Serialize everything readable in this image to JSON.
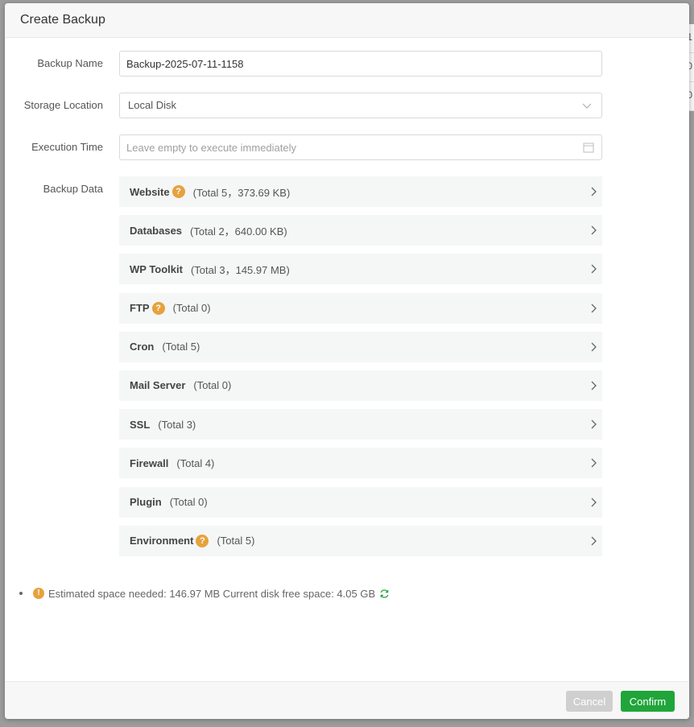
{
  "background": {
    "row_fragments": [
      "1",
      "0",
      "0"
    ]
  },
  "dialog": {
    "title": "Create Backup"
  },
  "form": {
    "backup_name": {
      "label": "Backup Name",
      "value": "Backup-2025-07-11-1158"
    },
    "storage_location": {
      "label": "Storage Location",
      "value": "Local Disk"
    },
    "execution_time": {
      "label": "Execution Time",
      "placeholder": "Leave empty to execute immediately"
    },
    "backup_data": {
      "label": "Backup Data",
      "items": [
        {
          "name": "Website",
          "help": true,
          "count": "(Total 5，373.69 KB)"
        },
        {
          "name": "Databases",
          "help": false,
          "count": "(Total 2，640.00 KB)"
        },
        {
          "name": "WP Toolkit",
          "help": false,
          "count": "(Total 3，145.97 MB)"
        },
        {
          "name": "FTP",
          "help": true,
          "count": "(Total 0)"
        },
        {
          "name": "Cron",
          "help": false,
          "count": "(Total 5)"
        },
        {
          "name": "Mail Server",
          "help": false,
          "count": "(Total 0)"
        },
        {
          "name": "SSL",
          "help": false,
          "count": "(Total 3)"
        },
        {
          "name": "Firewall",
          "help": false,
          "count": "(Total 4)"
        },
        {
          "name": "Plugin",
          "help": false,
          "count": "(Total 0)"
        },
        {
          "name": "Environment",
          "help": true,
          "count": "(Total 5)"
        }
      ]
    }
  },
  "estimate": {
    "text": "Estimated space needed: 146.97 MB Current disk free space: 4.05 GB"
  },
  "footer": {
    "cancel_label": "Cancel",
    "confirm_label": "Confirm"
  },
  "icons": {
    "help": "?",
    "warning": "!",
    "refresh": "refresh-icon",
    "calendar": "calendar-icon",
    "chevron_down": "chevron-down-icon",
    "chevron_right": "chevron-right-icon"
  },
  "colors": {
    "accent_green": "#20a53a",
    "help_orange": "#e6a23c",
    "cancel_gray": "#cfcfcf",
    "item_bg": "#f5f6f6"
  }
}
